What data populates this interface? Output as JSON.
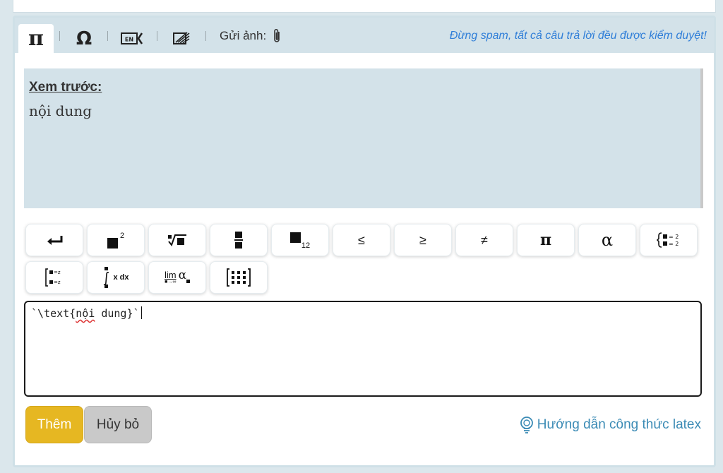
{
  "tabs": {
    "math_symbol": "π",
    "special_symbol": "Ω",
    "language_label": "EN",
    "upload_label": "Gửi ảnh:"
  },
  "notice": "Đừng spam, tất cả câu trả lời đều được kiểm duyệt!",
  "preview": {
    "label": "Xem trước:",
    "content": "nội dung"
  },
  "toolbar": {
    "buttons": [
      {
        "label": "↵"
      },
      {
        "label": "■²"
      },
      {
        "label": "∜■"
      },
      {
        "label": "■/■"
      },
      {
        "label": "■₁₂"
      },
      {
        "label": "≤"
      },
      {
        "label": "≥"
      },
      {
        "label": "≠"
      },
      {
        "label": "π"
      },
      {
        "label": "α"
      },
      {
        "label": "{■=2 ■=2"
      },
      {
        "label": "[■=z ■=z"
      },
      {
        "label": "∫ x dx"
      },
      {
        "label": "lim α"
      },
      {
        "label": "[⋮⋮⋮]"
      }
    ],
    "sup_2": "2",
    "sub_12": "12",
    "integral_suffix": "x dx",
    "lim_word": "lim",
    "lim_sub": "■→∞",
    "alpha": "α",
    "system_eq": "= 2",
    "matrix_eq": "=z"
  },
  "input": {
    "prefix": "`\\text{",
    "underlined_word": "nội",
    "suffix": " dung}`"
  },
  "actions": {
    "add_label": "Thêm",
    "cancel_label": "Hủy bỏ",
    "guide_label": "Hướng dẫn công thức latex"
  },
  "colors": {
    "accent_yellow": "#e6b722",
    "link_blue": "#2f7ed8",
    "panel_bg": "#d3e2e9",
    "guide_blue": "#3b8bb5"
  }
}
